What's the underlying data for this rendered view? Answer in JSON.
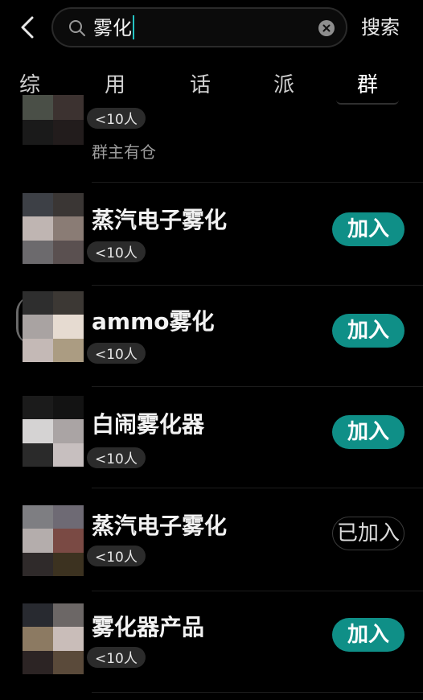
{
  "header": {
    "back_icon": "chevron-left-icon",
    "search_query": "雾化",
    "search_icon": "search-icon",
    "clear_icon": "clear-circle-icon",
    "search_action_label": "搜索"
  },
  "tabs": [
    {
      "label": "综"
    },
    {
      "label": "用"
    },
    {
      "label": "话"
    },
    {
      "label": "派"
    },
    {
      "label": "群"
    }
  ],
  "active_tab_index": 4,
  "colors": {
    "accent": "#0f8f87",
    "caret": "#25c3c3",
    "background": "#000000"
  },
  "groups": [
    {
      "name": "",
      "members": "<10人",
      "desc": "群主有仓",
      "action": ""
    },
    {
      "name": "蒸汽电子雾化",
      "members": "<10人",
      "desc": "",
      "action": "加入"
    },
    {
      "name": "ammo雾化",
      "members": "<10人",
      "desc": "",
      "action": "加入"
    },
    {
      "name": "白闹雾化器",
      "members": "<10人",
      "desc": "",
      "action": "加入"
    },
    {
      "name": "蒸汽电子雾化",
      "members": "<10人",
      "desc": "",
      "action": "已加入"
    },
    {
      "name": "雾化器产品",
      "members": "<10人",
      "desc": "",
      "action": "加入"
    }
  ]
}
